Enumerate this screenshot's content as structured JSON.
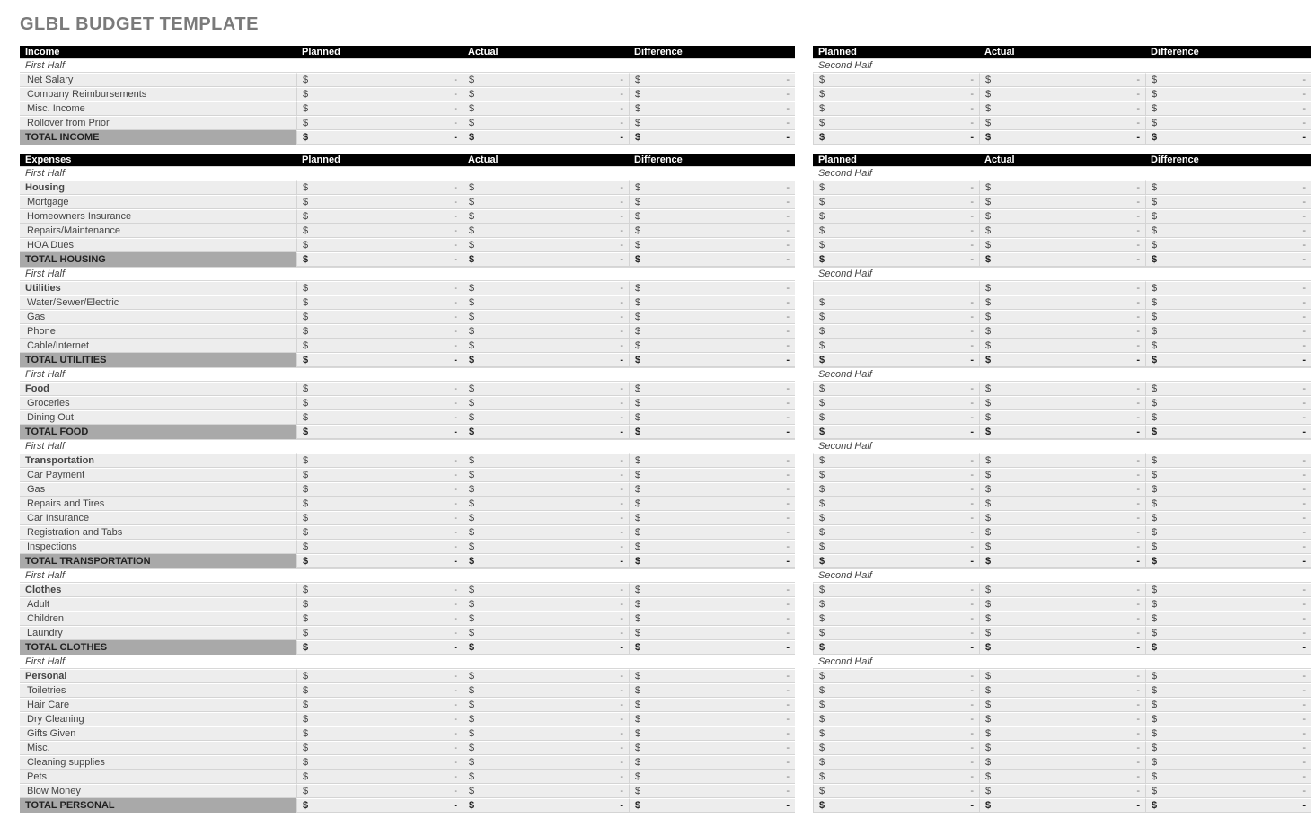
{
  "title": "GLBL BUDGET TEMPLATE",
  "columns": {
    "planned": "Planned",
    "actual": "Actual",
    "difference": "Difference"
  },
  "periods": {
    "first": "First Half",
    "second": "Second Half"
  },
  "sections": [
    {
      "header": "Income",
      "groups": [
        {
          "rows": [
            "Net Salary",
            "Company Reimbursements",
            "Misc. Income",
            "Rollover from Prior"
          ],
          "total": "TOTAL INCOME"
        }
      ]
    },
    {
      "header": "Expenses",
      "groups": [
        {
          "category": "Housing",
          "rows": [
            "Mortgage",
            "Homeowners Insurance",
            "Repairs/Maintenance",
            "HOA Dues"
          ],
          "total": "TOTAL HOUSING"
        },
        {
          "category": "Utilities",
          "rows": [
            "Water/Sewer/Electric",
            "Gas",
            "Phone",
            "Cable/Internet"
          ],
          "total": "TOTAL UTILITIES",
          "blankSecondFirstCell": true
        },
        {
          "category": "Food",
          "rows": [
            "Groceries",
            "Dining Out"
          ],
          "total": "TOTAL FOOD"
        },
        {
          "category": "Transportation",
          "rows": [
            "Car Payment",
            "Gas",
            "Repairs and Tires",
            "Car Insurance",
            "Registration and Tabs",
            "Inspections"
          ],
          "total": "TOTAL TRANSPORTATION"
        },
        {
          "category": "Clothes",
          "rows": [
            "Adult",
            "Children",
            "Laundry"
          ],
          "total": "TOTAL CLOTHES"
        },
        {
          "category": "Personal",
          "rows": [
            "Toiletries",
            "Hair Care",
            "Dry Cleaning",
            "Gifts Given",
            "Misc.",
            "Cleaning supplies",
            "Pets",
            "Blow Money"
          ],
          "total": "TOTAL PERSONAL"
        }
      ]
    }
  ]
}
